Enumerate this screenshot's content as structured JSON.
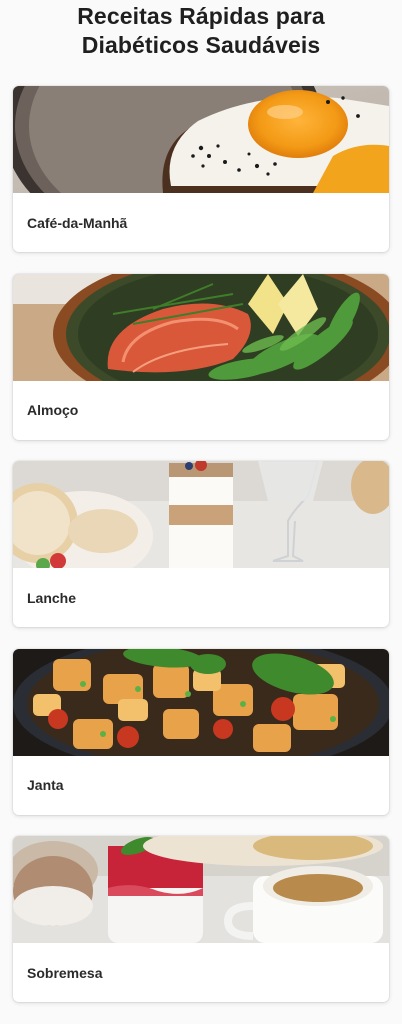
{
  "header": {
    "title_line1": "Receitas Rápidas para",
    "title_line2": "Diabéticos Saudáveis"
  },
  "categories": [
    {
      "label": "Café-da-Manhã",
      "image": "fried-egg-toast-photo"
    },
    {
      "label": "Almoço",
      "image": "salmon-greens-bowl-photo"
    },
    {
      "label": "Lanche",
      "image": "yogurt-parfait-photo"
    },
    {
      "label": "Janta",
      "image": "chicken-vegetable-pan-photo"
    },
    {
      "label": "Sobremesa",
      "image": "berry-dessert-cups-photo"
    }
  ]
}
